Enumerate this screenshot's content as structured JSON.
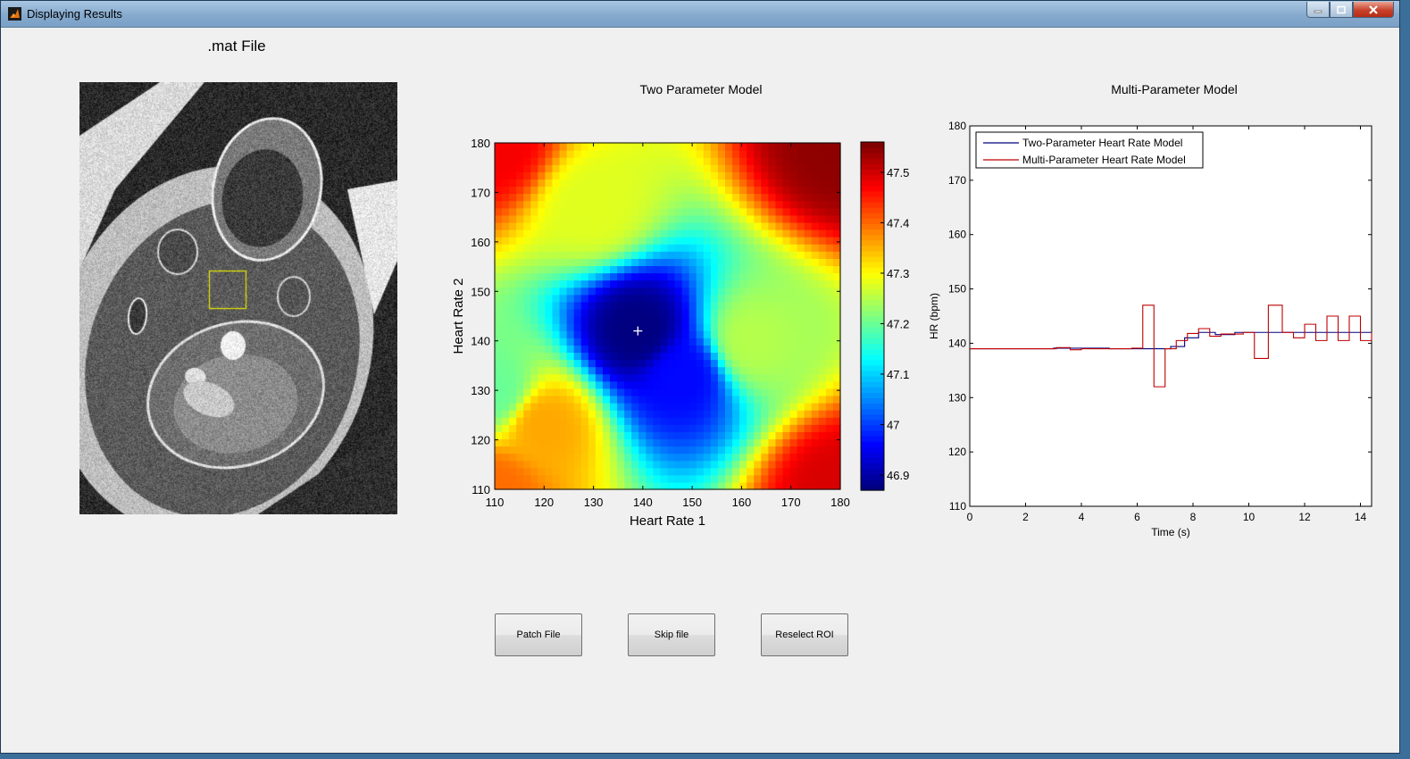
{
  "window": {
    "title": "Displaying Results"
  },
  "image_panel": {
    "title": ".mat File",
    "roi_color": "#e8e800"
  },
  "buttons": {
    "patch": "Patch File",
    "skip": "Skip file",
    "reselect": "Reselect ROI"
  },
  "chart_data": [
    {
      "type": "heatmap",
      "title": "Two Parameter Model",
      "xlabel": "Heart Rate 1",
      "ylabel": "Heart Rate 2",
      "xlim": [
        110,
        180
      ],
      "ylim": [
        110,
        180
      ],
      "xticks": [
        110,
        120,
        130,
        140,
        150,
        160,
        170,
        180
      ],
      "yticks": [
        110,
        120,
        130,
        140,
        150,
        160,
        170,
        180
      ],
      "colorbar": {
        "range": [
          46.87,
          47.56
        ],
        "ticks": [
          46.9,
          47,
          47.1,
          47.2,
          47.3,
          47.4,
          47.5
        ],
        "colormap": "jet"
      },
      "minimum_marker": [
        139,
        142
      ],
      "approx_surface_anchors": [
        {
          "x": 110,
          "y": 110,
          "value": 47.4
        },
        {
          "x": 120,
          "y": 123,
          "value": 47.36
        },
        {
          "x": 110,
          "y": 180,
          "value": 47.48
        },
        {
          "x": 180,
          "y": 180,
          "value": 47.55
        },
        {
          "x": 180,
          "y": 110,
          "value": 47.5
        },
        {
          "x": 130,
          "y": 167,
          "value": 47.28
        },
        {
          "x": 110,
          "y": 130,
          "value": 47.2
        },
        {
          "x": 139,
          "y": 142,
          "value": 46.87
        },
        {
          "x": 148,
          "y": 133,
          "value": 46.96
        },
        {
          "x": 162,
          "y": 140,
          "value": 47.25
        }
      ]
    },
    {
      "type": "line",
      "title": "Multi-Parameter Model",
      "xlabel": "Time (s)",
      "ylabel": "HR (bpm)",
      "xlim": [
        0,
        14.4
      ],
      "ylim": [
        110,
        180
      ],
      "xticks": [
        0,
        2,
        4,
        6,
        8,
        10,
        12,
        14
      ],
      "yticks": [
        110,
        120,
        130,
        140,
        150,
        160,
        170,
        180
      ],
      "legend_position": "top-left",
      "series": [
        {
          "name": "Two-Parameter Heart Rate Model",
          "color": "#00007f",
          "step": true,
          "x": [
            0,
            3.0,
            3.5,
            5.0,
            6.2,
            6.6,
            7.2,
            7.7,
            8.2,
            8.8,
            9.5,
            10.0,
            10.5,
            11.0,
            14.4
          ],
          "y": [
            139,
            139.1,
            139.1,
            139,
            139,
            139,
            139.4,
            141,
            142,
            141.6,
            142,
            142,
            142,
            142,
            142
          ]
        },
        {
          "name": "Multi-Parameter Heart Rate Model",
          "color": "#bf0000",
          "step": true,
          "x": [
            0,
            3.1,
            3.6,
            4.0,
            5.8,
            6.2,
            6.6,
            7.0,
            7.4,
            7.8,
            8.2,
            8.6,
            9.0,
            9.8,
            10.2,
            10.7,
            11.2,
            11.6,
            12.0,
            12.4,
            12.8,
            13.2,
            13.6,
            14.0,
            14.4
          ],
          "y": [
            139,
            139.2,
            138.8,
            139,
            139.1,
            147,
            132,
            139,
            140.5,
            141.8,
            142.7,
            141.3,
            141.7,
            142,
            137.2,
            147,
            142,
            141,
            143.5,
            140.5,
            145,
            140.5,
            145,
            140.5,
            142
          ]
        }
      ]
    }
  ]
}
